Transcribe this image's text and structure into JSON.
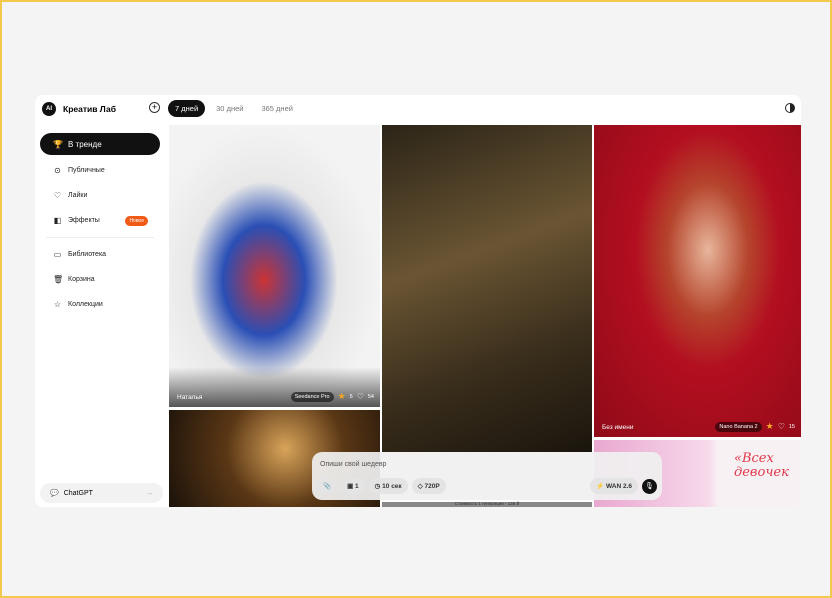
{
  "app": {
    "name": "Креатив Лаб",
    "logo": "AI"
  },
  "tabs": [
    {
      "label": "7 дней",
      "active": true
    },
    {
      "label": "30 дней"
    },
    {
      "label": "365 дней"
    }
  ],
  "nav": [
    {
      "label": "В тренде",
      "icon": "trophy-icon"
    },
    {
      "label": "Публичные"
    },
    {
      "label": "Лайки"
    },
    {
      "label": "Эффекты",
      "badge": "Новое"
    },
    {
      "label": "Библиотека"
    },
    {
      "label": "Корзина"
    },
    {
      "label": "Коллекции"
    }
  ],
  "chat": {
    "label": "ChatGPT",
    "arrow": "→"
  },
  "cards": [
    {
      "author": "Наталья",
      "model": "Seedance Pro",
      "stars": "5",
      "likes": "54"
    },
    {
      "author": "Без имени",
      "model": "Nano Banana 2",
      "stars": "",
      "likes": "15"
    }
  ],
  "poster_text": "«Всех девочек",
  "cost_text": "Стоимость 1 генерации - 128 ₽",
  "prompt": {
    "placeholder": "Опиши свой шедевр",
    "count": "1",
    "duration": "10 сек",
    "quality": "720P",
    "model": "WAN 2.6"
  }
}
